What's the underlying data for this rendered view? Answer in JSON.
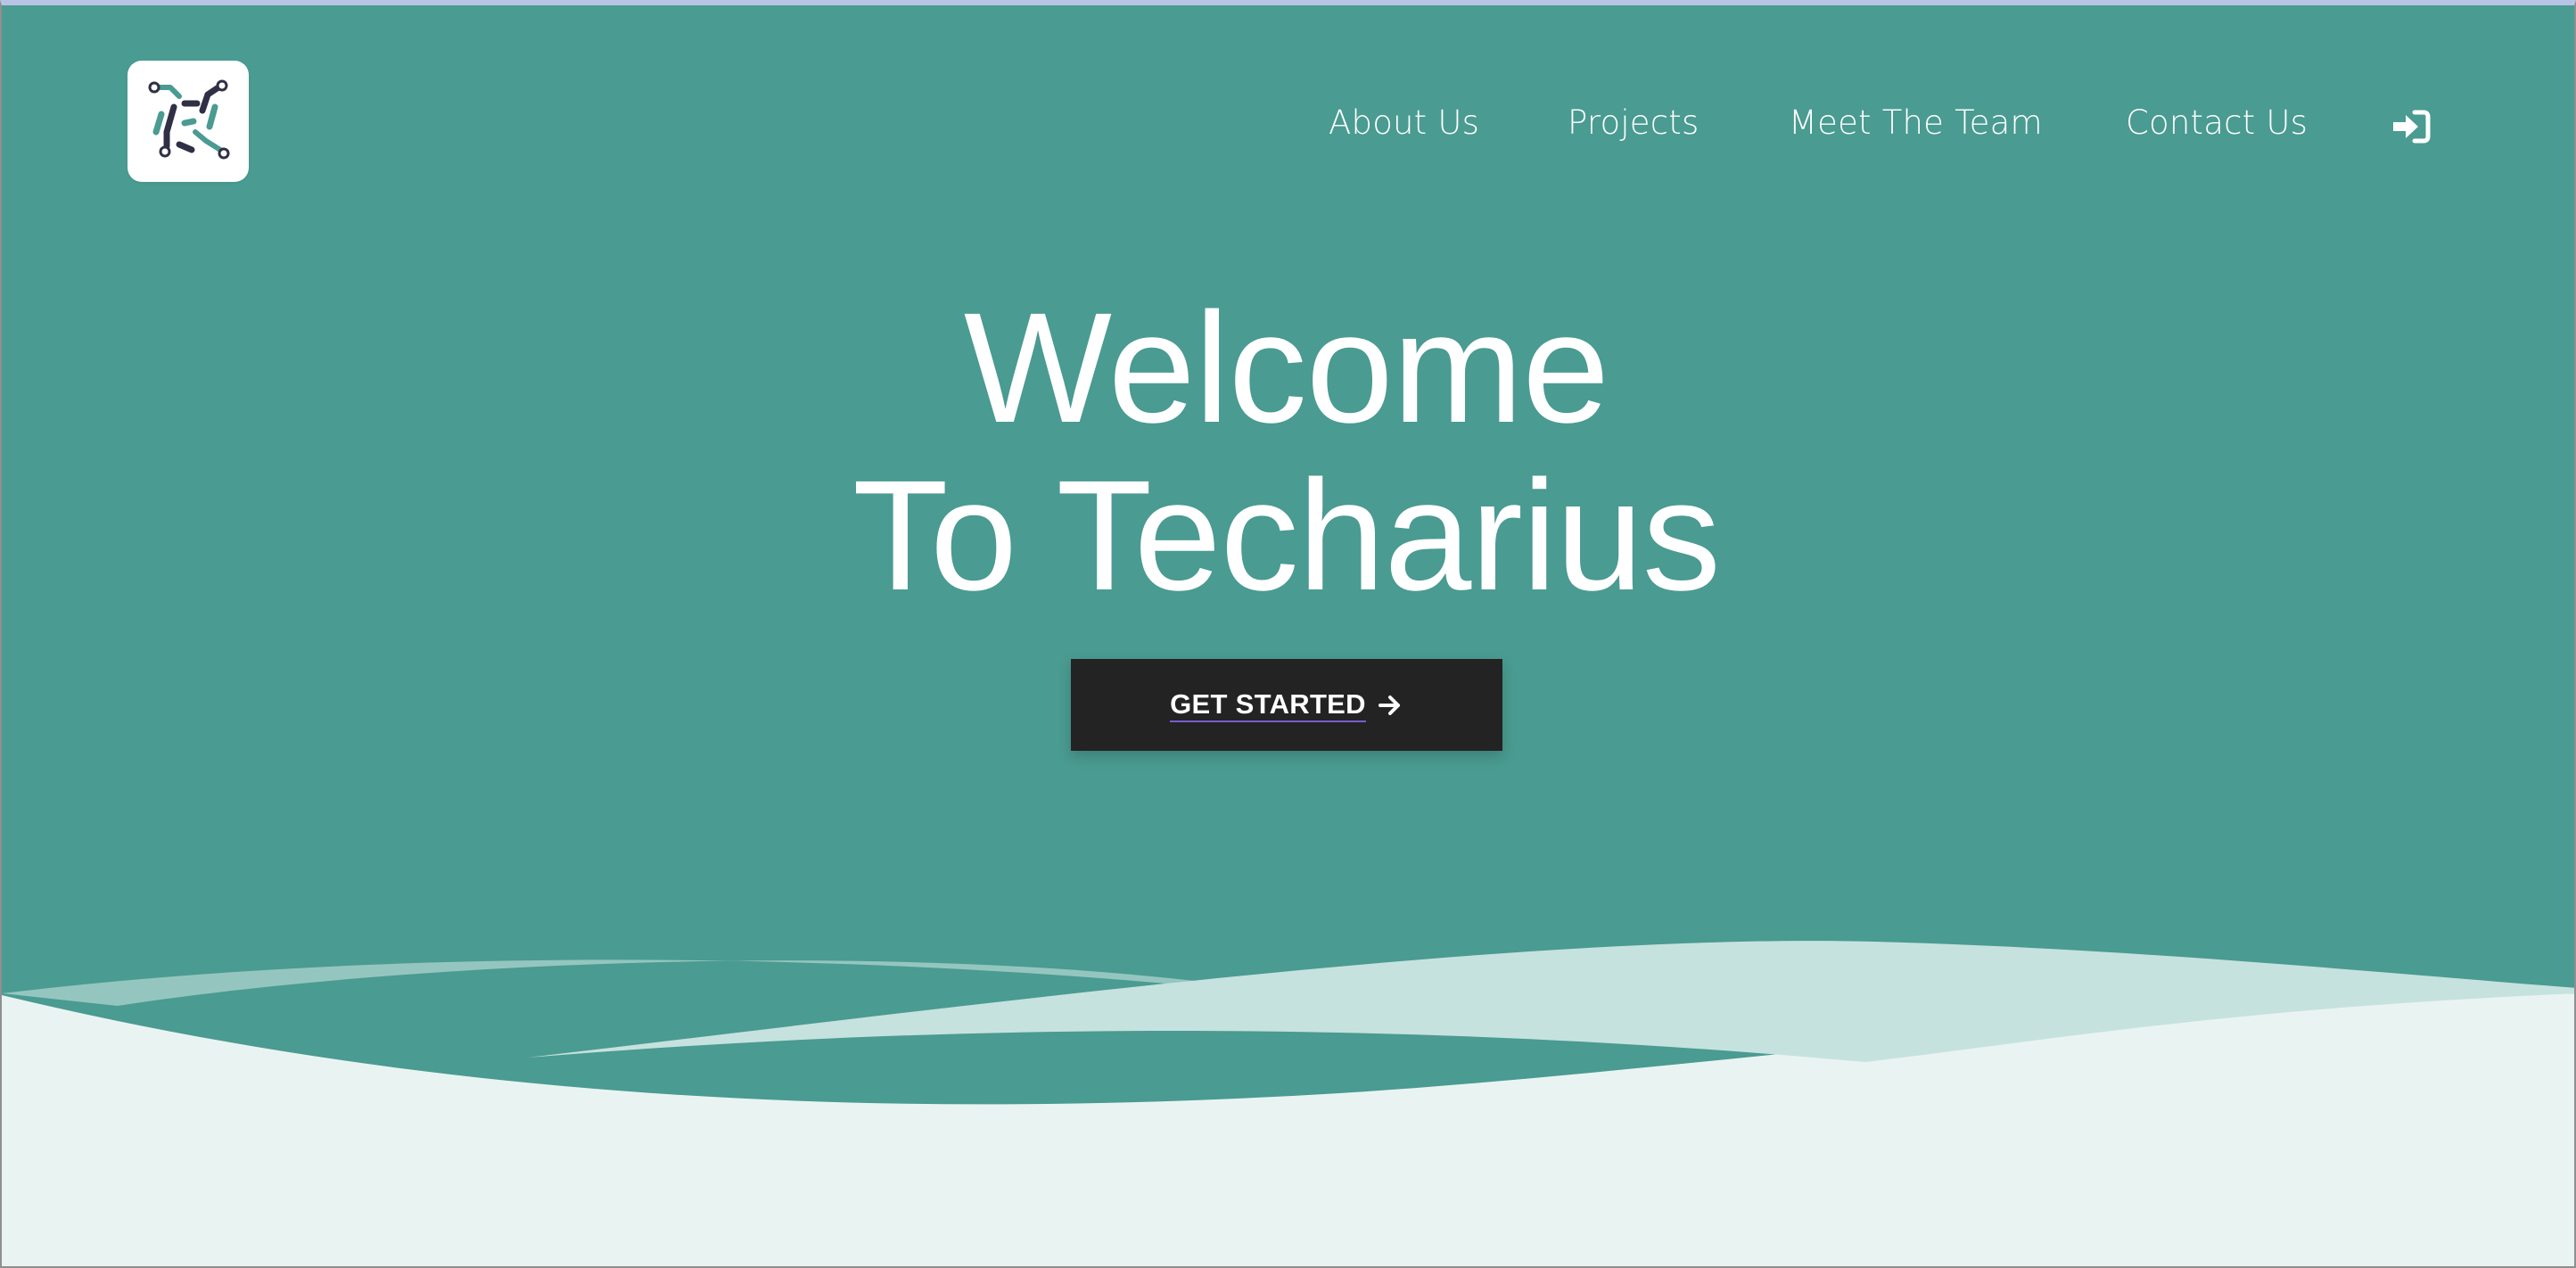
{
  "colors": {
    "hero_background": "#4a9b91",
    "wave_light": "#c6e2de",
    "wave_lighter": "#e9f4f2",
    "button_background": "#232323",
    "text_white": "#ffffff"
  },
  "brand": {
    "logo_icon": "circuit-logo-icon"
  },
  "nav": {
    "items": [
      {
        "label": "About Us"
      },
      {
        "label": "Projects"
      },
      {
        "label": "Meet The Team"
      },
      {
        "label": "Contact Us"
      }
    ],
    "signin_icon": "sign-in-icon"
  },
  "hero": {
    "title_line1": "Welcome",
    "title_line2": "To Techarius",
    "cta_label": "GET STARTED",
    "cta_icon": "arrow-right-icon"
  }
}
